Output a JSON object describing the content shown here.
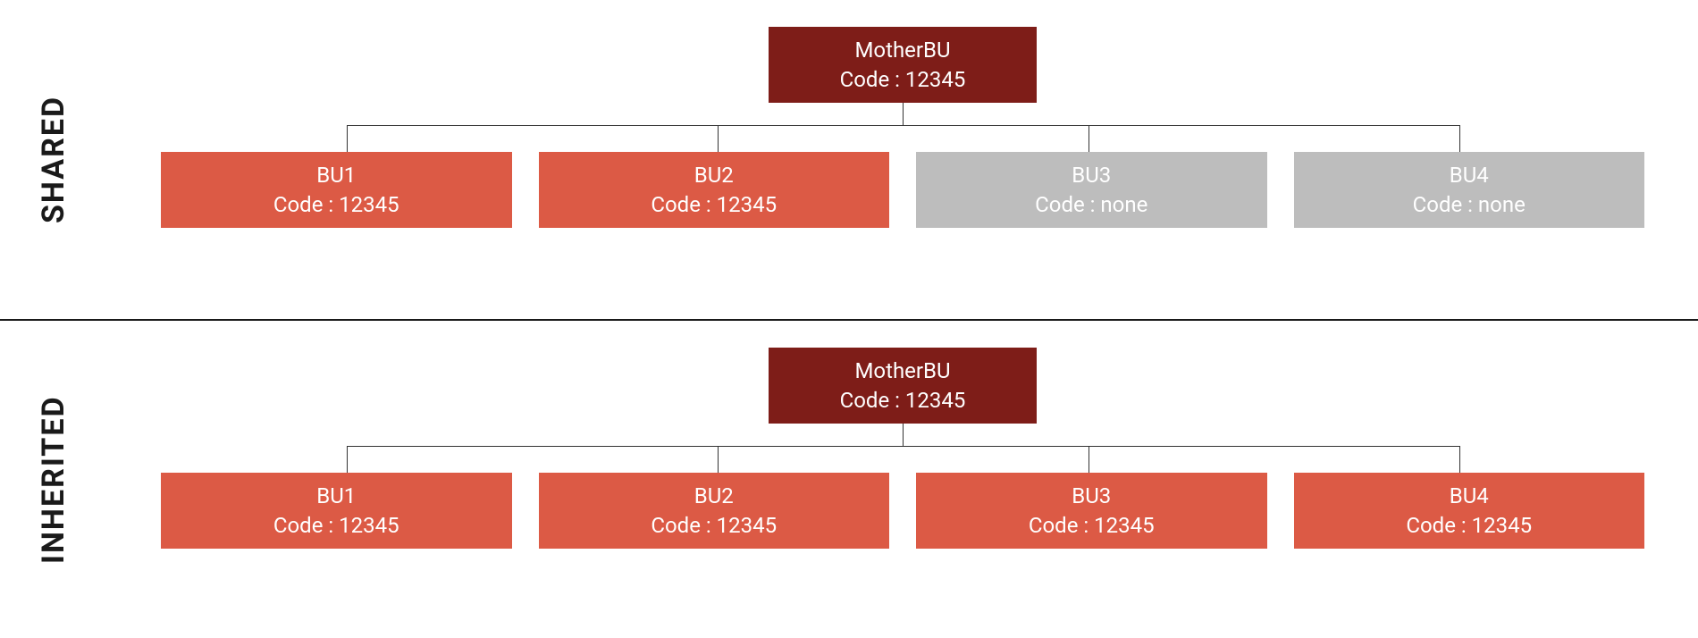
{
  "colors": {
    "parent_bg": "#7e1d18",
    "active_child_bg": "#dc5a45",
    "inactive_child_bg": "#bdbdbd",
    "text": "#ffffff"
  },
  "sections": {
    "shared": {
      "label": "SHARED",
      "parent": {
        "name": "MotherBU",
        "code_label": "Code : 12345"
      },
      "children": [
        {
          "name": "BU1",
          "code_label": "Code : 12345",
          "state": "active"
        },
        {
          "name": "BU2",
          "code_label": "Code : 12345",
          "state": "active"
        },
        {
          "name": "BU3",
          "code_label": "Code : none",
          "state": "inactive"
        },
        {
          "name": "BU4",
          "code_label": "Code : none",
          "state": "inactive"
        }
      ]
    },
    "inherited": {
      "label": "INHERITED",
      "parent": {
        "name": "MotherBU",
        "code_label": "Code : 12345"
      },
      "children": [
        {
          "name": "BU1",
          "code_label": "Code : 12345",
          "state": "active"
        },
        {
          "name": "BU2",
          "code_label": "Code : 12345",
          "state": "active"
        },
        {
          "name": "BU3",
          "code_label": "Code : 12345",
          "state": "active"
        },
        {
          "name": "BU4",
          "code_label": "Code : 12345",
          "state": "active"
        }
      ]
    }
  }
}
